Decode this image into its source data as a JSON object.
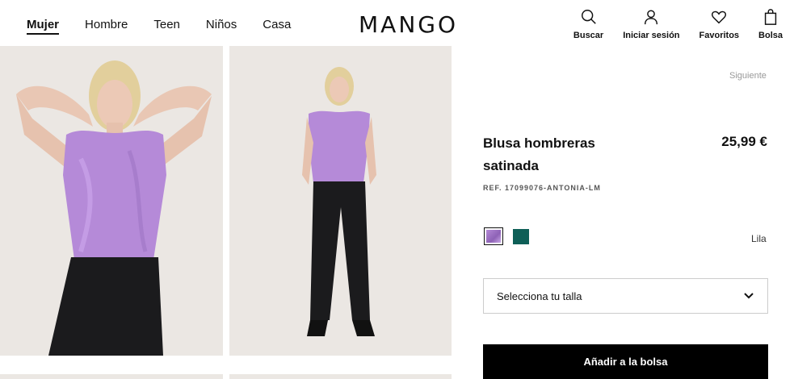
{
  "nav": {
    "items": [
      {
        "label": "Mujer",
        "active": true
      },
      {
        "label": "Hombre"
      },
      {
        "label": "Teen"
      },
      {
        "label": "Niños"
      },
      {
        "label": "Casa"
      }
    ]
  },
  "brand": {
    "logo": "MANGO"
  },
  "actions": [
    {
      "label": "Buscar",
      "icon": "search-icon"
    },
    {
      "label": "Iniciar sesión",
      "icon": "user-icon"
    },
    {
      "label": "Favoritos",
      "icon": "heart-icon"
    },
    {
      "label": "Bolsa",
      "icon": "bag-icon"
    }
  ],
  "product": {
    "next": "Siguiente",
    "title": "Blusa hombreras satinada",
    "price": "25,99 €",
    "ref": "REF. 17099076-ANTONIA-LM",
    "selected_color": "Lila",
    "colors": [
      "#a67fcc",
      "#0e5f57"
    ],
    "size_placeholder": "Selecciona tu talla",
    "add_to_bag": "Añadir a la bolsa"
  }
}
